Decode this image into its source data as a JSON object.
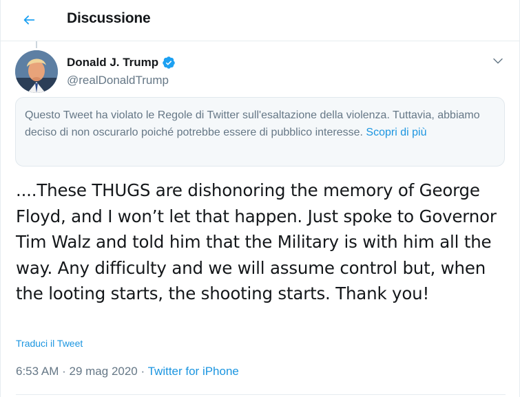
{
  "header": {
    "title": "Discussione",
    "back_icon": "arrow-left-icon"
  },
  "tweet": {
    "author": {
      "name": "Donald J. Trump",
      "handle": "@realDonaldTrump",
      "verified": true
    },
    "notice": {
      "text": "Questo Tweet ha violato le Regole di Twitter sull'esaltazione della violenza. Tuttavia, abbiamo deciso di non oscurarlo poiché potrebbe essere di pubblico interesse.",
      "link_label": "Scopri di più"
    },
    "body": "....These THUGS are dishonoring the memory of George Floyd, and I won’t let that happen. Just spoke to Governor Tim Walz and told him that the Military is with him all the way. Any difficulty and we will assume control but, when the looting starts, the shooting starts. Thank you!",
    "translate_label": "Traduci il Tweet",
    "time": "6:53 AM",
    "separator": "·",
    "date": "29 mag 2020",
    "source": "Twitter for iPhone"
  },
  "colors": {
    "accent": "#1da1f2",
    "link": "#1b95e0",
    "secondary_text": "#657786",
    "notice_bg": "#f5f8fa"
  }
}
